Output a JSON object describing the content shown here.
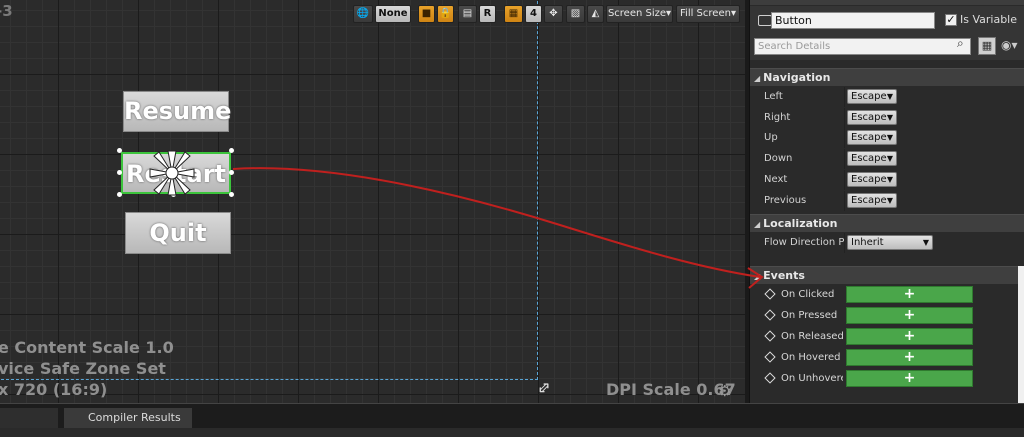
{
  "viewport": {
    "resolution_label": "-3",
    "content_scale": "e Content Scale 1.0",
    "safe_zone": "vice Safe Zone Set",
    "resolution": "x 720 (16:9)",
    "dpi_scale": "DPI Scale 0.67",
    "buttons": {
      "resume": "Resume",
      "restart": "Restart",
      "quit": "Quit"
    },
    "toolbar": {
      "none_label": "None",
      "r_label": "R",
      "grid_value": "4",
      "screen_size": "Screen Size",
      "fill_screen": "Fill Screen"
    }
  },
  "details": {
    "widget_name": "Button",
    "is_variable_label": "Is Variable",
    "is_variable_checked": "✓",
    "search_placeholder": "Search Details",
    "navigation": {
      "title": "Navigation",
      "rows": [
        {
          "label": "Left",
          "value": "Escape"
        },
        {
          "label": "Right",
          "value": "Escape"
        },
        {
          "label": "Up",
          "value": "Escape"
        },
        {
          "label": "Down",
          "value": "Escape"
        },
        {
          "label": "Next",
          "value": "Escape"
        },
        {
          "label": "Previous",
          "value": "Escape"
        }
      ]
    },
    "localization": {
      "title": "Localization",
      "flow_label": "Flow Direction Pre",
      "flow_value": "Inherit"
    },
    "events": {
      "title": "Events",
      "add_label": "+",
      "rows": [
        "On Clicked",
        "On Pressed",
        "On Released",
        "On Hovered",
        "On Unhoverec"
      ]
    }
  },
  "bottom_tabs": {
    "compiler_results": "Compiler Results"
  },
  "colors": {
    "event_button": "#4aa64a",
    "selection_outline": "#3cc43c",
    "annotation_arrow": "#c0201e",
    "safe_zone_line": "#5aa6d6"
  }
}
